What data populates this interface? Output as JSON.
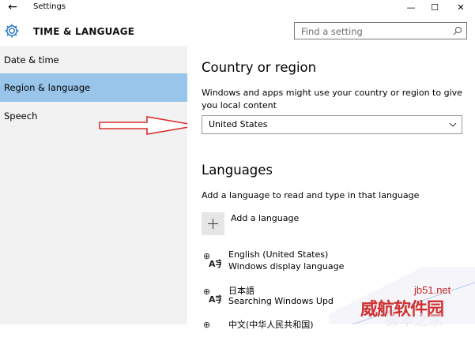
{
  "window": {
    "title": "Settings",
    "back_glyph": "←",
    "minimize_glyph": "—",
    "maximize_glyph": "☐",
    "close_glyph": "✕"
  },
  "header": {
    "app_title": "TIME & LANGUAGE",
    "search_placeholder": "Find a setting",
    "icons": [
      "gear-icon",
      "search-icon"
    ]
  },
  "sidebar": {
    "items": [
      {
        "label": "Date & time",
        "active": false
      },
      {
        "label": "Region & language",
        "active": true
      },
      {
        "label": "Speech",
        "active": false
      }
    ]
  },
  "region": {
    "heading": "Country or region",
    "description": "Windows and apps might use your country or region to give you local content",
    "selected": "United States"
  },
  "languages": {
    "heading": "Languages",
    "description": "Add a language to read and type in that language",
    "add_label": "Add a language",
    "items": [
      {
        "name": "English (United States)",
        "status": "Windows display language"
      },
      {
        "name": "日本語",
        "status": "Searching Windows Upd"
      },
      {
        "name": "中文(中华人民共和国)",
        "status": ""
      }
    ]
  },
  "watermark": {
    "site": "jb51.net",
    "brand": "威航软件园",
    "brand2": "脚本之家"
  },
  "colors": {
    "sidebar_bg": "#f2f2f2",
    "active_item": "#99c5ea",
    "arrow": "#d9302b"
  }
}
